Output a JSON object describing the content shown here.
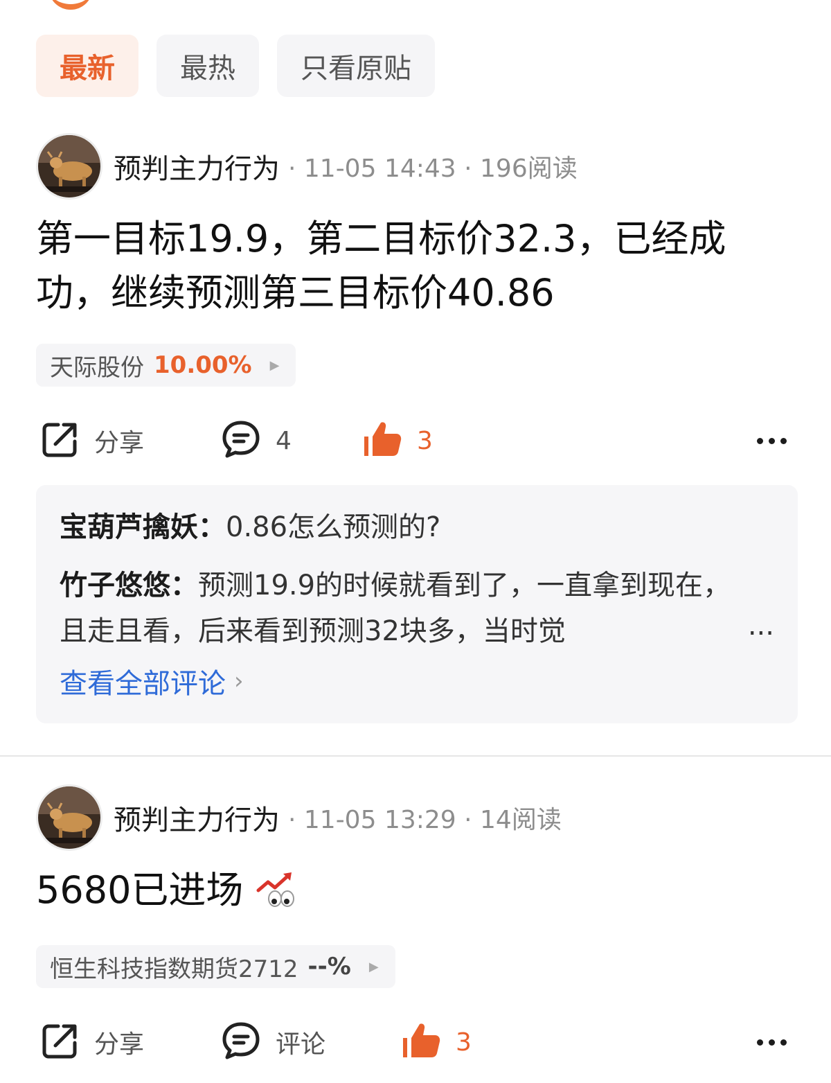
{
  "tabs": [
    {
      "label": "最新",
      "active": true
    },
    {
      "label": "最热",
      "active": false
    },
    {
      "label": "只看原贴",
      "active": false
    }
  ],
  "posts": [
    {
      "author": "预判主力行为",
      "meta": "· 11-05 14:43 · 196阅读",
      "text": "第一目标19.9，第二目标价32.3，已经成功，继续预测第三目标价40.86",
      "stock": {
        "name": "天际股份",
        "change": "10.00%"
      },
      "share_label": "分享",
      "comment_label": "4",
      "like_count": "3",
      "comments": [
        {
          "name": "宝葫芦擒妖：",
          "text": "0.86怎么预测的?"
        },
        {
          "name": "竹子悠悠：",
          "text": "预测19.9的时候就看到了，一直拿到现在，且走且看，后来看到预测32块多，当时觉"
        }
      ],
      "comments_ellipsis": "...",
      "see_all_label": "查看全部评论"
    },
    {
      "author": "预判主力行为",
      "meta": "· 11-05 13:29 · 14阅读",
      "text": "5680已进场",
      "stock": {
        "name": "恒生科技指数期货2712",
        "change": "--%"
      },
      "share_label": "分享",
      "comment_label": "评论",
      "like_count": "3"
    }
  ],
  "colors": {
    "accent": "#e8612c",
    "link": "#2f6bd8",
    "chip_bg": "#f5f5f7"
  }
}
